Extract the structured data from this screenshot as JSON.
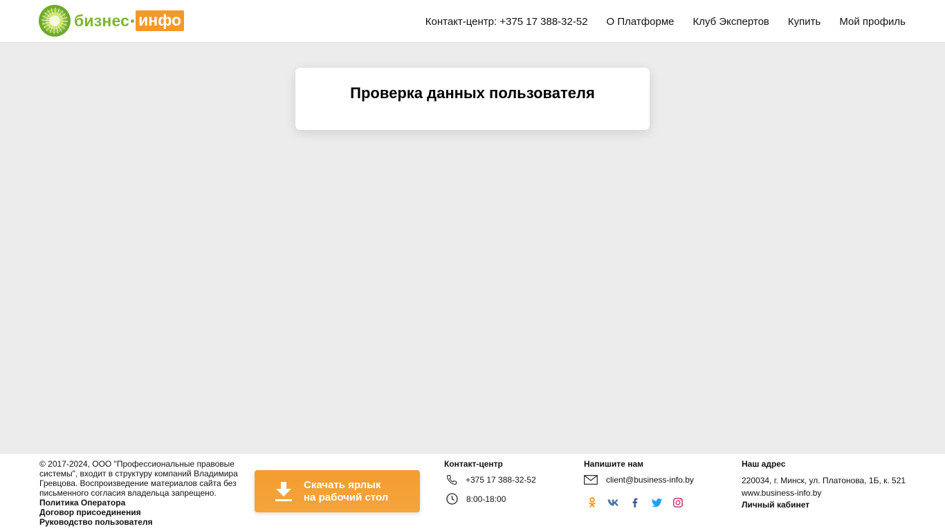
{
  "header": {
    "logo": {
      "word1": "бизнес",
      "word2": "инфо"
    },
    "nav": [
      {
        "label": "Контакт-центр: +375 17 388-32-52"
      },
      {
        "label": "О Платформе"
      },
      {
        "label": "Клуб Экспертов"
      },
      {
        "label": "Купить"
      },
      {
        "label": "Мой профиль"
      }
    ]
  },
  "main": {
    "card_title": "Проверка данных пользователя"
  },
  "footer": {
    "copyright": "© 2017-2024, ООО \"Профессиональные правовые системы\", входит в структуру компаний Владимира Гревцова. Воспроизведение материалов сайта без письменного согласия владельца запрещено.",
    "links": [
      {
        "label": "Политика Оператора"
      },
      {
        "label": "Договор присоединения"
      },
      {
        "label": "Руководство пользователя"
      }
    ],
    "download_button": {
      "line1": "Скачать ярлык",
      "line2": "на рабочий стол"
    },
    "contact": {
      "title": "Контакт-центр",
      "phone": "+375 17 388-32-52",
      "hours": "8:00-18:00"
    },
    "write": {
      "title": "Напишите нам",
      "email": "client@business-info.by"
    },
    "address": {
      "title": "Наш адрес",
      "line": "220034, г. Минск, ул. Платонова, 1Б, к. 521",
      "site": "www.business-info.by",
      "cabinet": "Личный кабинет"
    },
    "socials": [
      "odnoklassniki-icon",
      "vk-icon",
      "facebook-icon",
      "twitter-icon",
      "instagram-icon"
    ]
  },
  "colors": {
    "brand_green": "#7eb62b",
    "brand_orange": "#f3992a",
    "background": "#ececec"
  }
}
